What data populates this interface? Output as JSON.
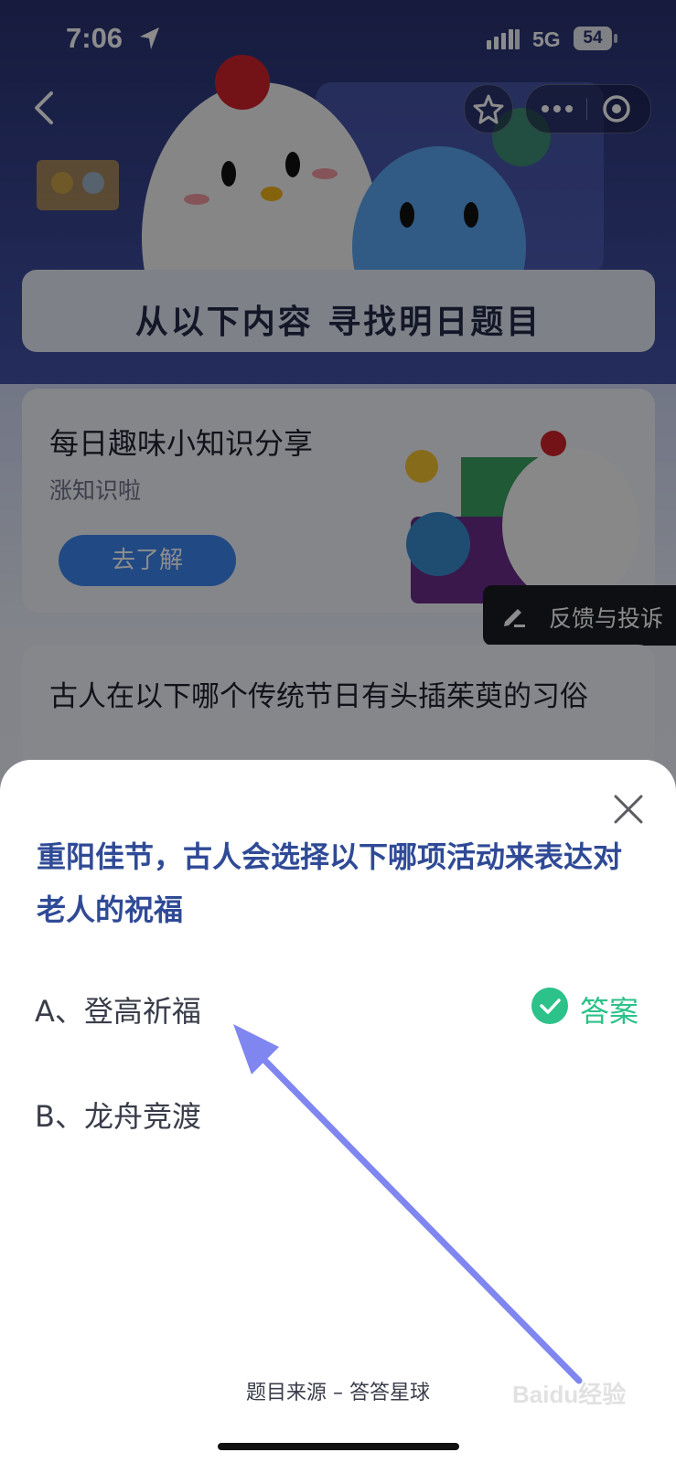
{
  "status_bar": {
    "time": "7:06",
    "network": "5G",
    "battery": "54"
  },
  "page": {
    "section_title": "从以下内容 寻找明日题目",
    "info_card": {
      "title": "每日趣味小知识分享",
      "subtitle": "涨知识啦",
      "button_label": "去了解"
    },
    "feedback_label": "反馈与投诉",
    "question_card_title": "古人在以下哪个传统节日有头插茱萸的习俗"
  },
  "sheet": {
    "question": "重阳佳节，古人会选择以下哪项活动来表达对老人的祝福",
    "options": [
      {
        "label": "A、登高祈福",
        "is_answer": true
      },
      {
        "label": "B、龙舟竞渡",
        "is_answer": false
      }
    ],
    "answer_label": "答案",
    "source": "题目来源 – 答答星球"
  },
  "watermark": "Baidu经验",
  "colors": {
    "question_text": "#2f4a96",
    "answer_green": "#2cc28a",
    "hero_bg": "#2a3372",
    "go_button": "#3d88f2",
    "arrow": "#7f86f0"
  },
  "icons": [
    "location-arrow-icon",
    "signal-icon",
    "back-chevron-icon",
    "star-icon",
    "more-dots-icon",
    "target-icon",
    "edit-pen-icon",
    "close-x-icon",
    "check-icon"
  ]
}
